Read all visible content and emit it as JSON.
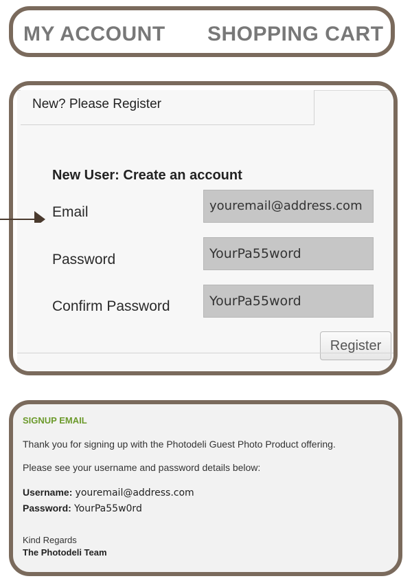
{
  "nav": {
    "my_account": "MY ACCOUNT",
    "shopping_cart": "SHOPPING CART"
  },
  "register": {
    "tab_label": "New? Please Register",
    "form_title": "New User: Create an account",
    "email_label": "Email",
    "email_value": "youremail@address.com",
    "password_label": "Password",
    "password_value": "YourPa55word",
    "confirm_label": "Confirm Password",
    "confirm_value": "YourPa55word",
    "button_label": "Register"
  },
  "signup_email": {
    "heading": "SIGNUP EMAIL",
    "thank_you": "Thank you for signing up with the Photodeli Guest Photo Product offering.",
    "details_intro": "Please see your username and password details below:",
    "username_label": "Username:",
    "username_value": "youremail@address.com",
    "password_label": "Password:",
    "password_value": "YourPa55w0rd",
    "regards": "Kind Regards",
    "team": "The Photodeli Team"
  },
  "colors": {
    "frame": "#7a6a5c",
    "heading_green": "#6c9a2c",
    "input_bg": "#c6c6c6"
  },
  "icons": {
    "pointer": "arrow-right-icon"
  }
}
